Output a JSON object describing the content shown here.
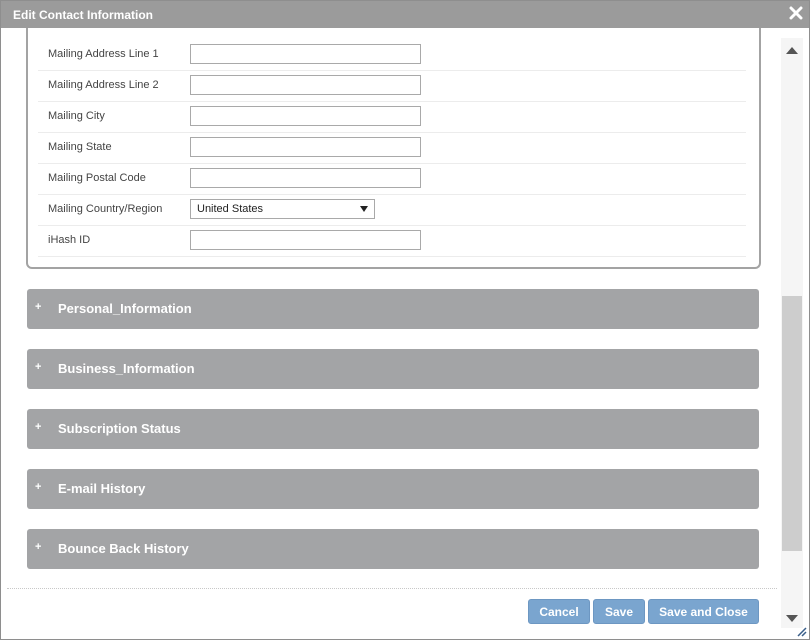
{
  "dialog": {
    "title": "Edit Contact Information",
    "close_icon": "close-icon"
  },
  "form": {
    "rows": [
      {
        "label": "Mailing Address Line 1",
        "value": ""
      },
      {
        "label": "Mailing Address Line 2",
        "value": ""
      },
      {
        "label": "Mailing City",
        "value": ""
      },
      {
        "label": "Mailing State",
        "value": ""
      },
      {
        "label": "Mailing Postal Code",
        "value": ""
      },
      {
        "label": "Mailing Country/Region",
        "value": "United States"
      },
      {
        "label": "iHash ID",
        "value": ""
      }
    ]
  },
  "sections": [
    {
      "icon": "+",
      "title": "Personal_Information"
    },
    {
      "icon": "+",
      "title": "Business_Information"
    },
    {
      "icon": "+",
      "title": "Subscription Status"
    },
    {
      "icon": "+",
      "title": "E-mail History"
    },
    {
      "icon": "+",
      "title": "Bounce Back History"
    }
  ],
  "buttons": {
    "cancel": "Cancel",
    "save": "Save",
    "save_close": "Save and Close"
  },
  "colors": {
    "titlebar": "#9b9b9b",
    "section": "#a3a4a6",
    "button": "#7aa5cf"
  }
}
